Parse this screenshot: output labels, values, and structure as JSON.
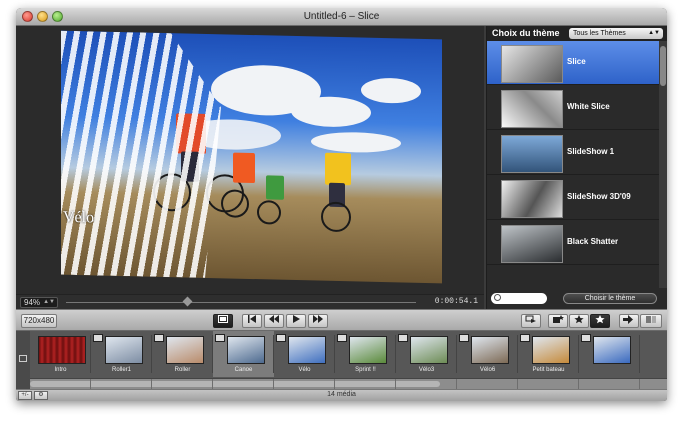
{
  "window": {
    "title": "Untitled-6 – Slice"
  },
  "preview": {
    "overlay_text": "Vélo"
  },
  "scrubber": {
    "zoom": "94%",
    "timecode": "0:00:54.1"
  },
  "themes": {
    "title": "Choix du thème",
    "filter": "Tous les Thèmes",
    "items": [
      {
        "label": "Slice",
        "selected": true
      },
      {
        "label": "White Slice",
        "selected": false
      },
      {
        "label": "SlideShow 1",
        "selected": false
      },
      {
        "label": "SlideShow 3D'09",
        "selected": false
      },
      {
        "label": "Black Shatter",
        "selected": false
      }
    ],
    "choose_label": "Choisir le thème"
  },
  "toolbar": {
    "size_label": "720x480"
  },
  "clips": [
    {
      "label": "Intro",
      "type": "intro",
      "color": "#8b1a1a"
    },
    {
      "label": "Roller1",
      "type": "image",
      "color": "#7d8da3"
    },
    {
      "label": "Roller",
      "type": "image",
      "color": "#b98b6a"
    },
    {
      "label": "Canoe",
      "type": "image",
      "color": "#4d6a8f",
      "selected": true
    },
    {
      "label": "Vélo",
      "type": "image",
      "color": "#3f6fbf"
    },
    {
      "label": "Sprint !!",
      "type": "image",
      "color": "#5a8a3a"
    },
    {
      "label": "Vélo3",
      "type": "image",
      "color": "#6d8c55"
    },
    {
      "label": "Vélo6",
      "type": "image",
      "color": "#7d6a55"
    },
    {
      "label": "Petit bateau",
      "type": "image",
      "color": "#c58a3a"
    },
    {
      "label": "",
      "type": "image",
      "color": "#3a6abf"
    }
  ],
  "status": {
    "media_count": "14 média"
  }
}
